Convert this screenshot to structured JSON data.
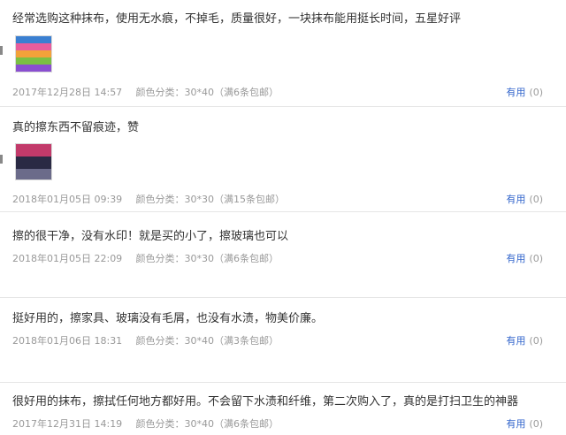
{
  "reviews": [
    {
      "text": "经常选购这种抹布，使用无水痕，不掉毛，质量很好，一块抹布能用挺长时间，五星好评",
      "date": "2017年12月28日 14:57",
      "sku": "颜色分类：30*40（满6条包邮）",
      "useful_label": "有用",
      "useful_count": "(0)",
      "has_image": true,
      "image_colors": [
        "#3a7fd1",
        "#e85d9c",
        "#f2a23a",
        "#7ac043",
        "#8a4fd0"
      ]
    },
    {
      "text": "真的擦东西不留痕迹，赞",
      "date": "2018年01月05日 09:39",
      "sku": "颜色分类：30*30（满15条包邮）",
      "useful_label": "有用",
      "useful_count": "(0)",
      "has_image": true,
      "image_colors": [
        "#c23a6a",
        "#2a2a44",
        "#6b6b8a"
      ]
    },
    {
      "text": "擦的很干净，没有水印！就是买的小了，擦玻璃也可以",
      "date": "2018年01月05日 22:09",
      "sku": "颜色分类：30*30（满6条包邮）",
      "useful_label": "有用",
      "useful_count": "(0)",
      "has_image": false
    },
    {
      "text": "挺好用的，擦家具、玻璃没有毛屑，也没有水渍，物美价廉。",
      "date": "2018年01月06日 18:31",
      "sku": "颜色分类：30*40（满3条包邮）",
      "useful_label": "有用",
      "useful_count": "(0)",
      "has_image": false
    },
    {
      "text": "很好用的抹布，擦拭任何地方都好用。不会留下水渍和纤维，第二次购入了，真的是打扫卫生的神器",
      "date": "2017年12月31日 14:19",
      "sku": "颜色分类：30*40（满6条包邮）",
      "useful_label": "有用",
      "useful_count": "(0)",
      "has_image": false
    }
  ]
}
